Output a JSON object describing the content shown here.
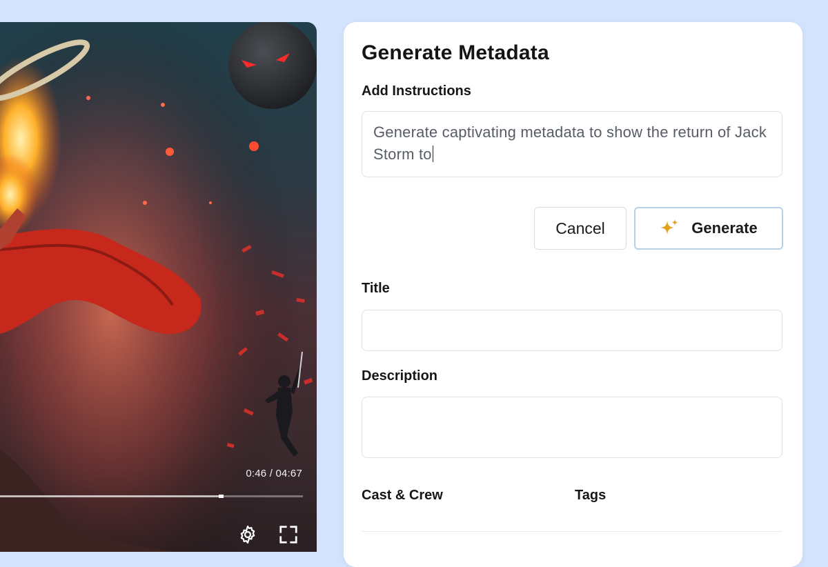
{
  "video": {
    "timecode": "0:46 / 04:67",
    "progress": 0.73,
    "controls": [
      "settings-icon",
      "fullscreen-icon"
    ]
  },
  "panel": {
    "title": "Generate Metadata",
    "instructions_label": "Add Instructions",
    "instructions_value": "Generate captivating metadata to show the return of Jack Storm to",
    "cancel_label": "Cancel",
    "generate_label": "Generate",
    "generate_icon": "sparkle-icon",
    "title_label": "Title",
    "title_value": "",
    "description_label": "Description",
    "description_value": "",
    "cast_label": "Cast & Crew",
    "tags_label": "Tags"
  },
  "colors": {
    "background": "#d4e3fd",
    "sparkle": "#e3a21a",
    "field_border": "#dde3ea"
  }
}
